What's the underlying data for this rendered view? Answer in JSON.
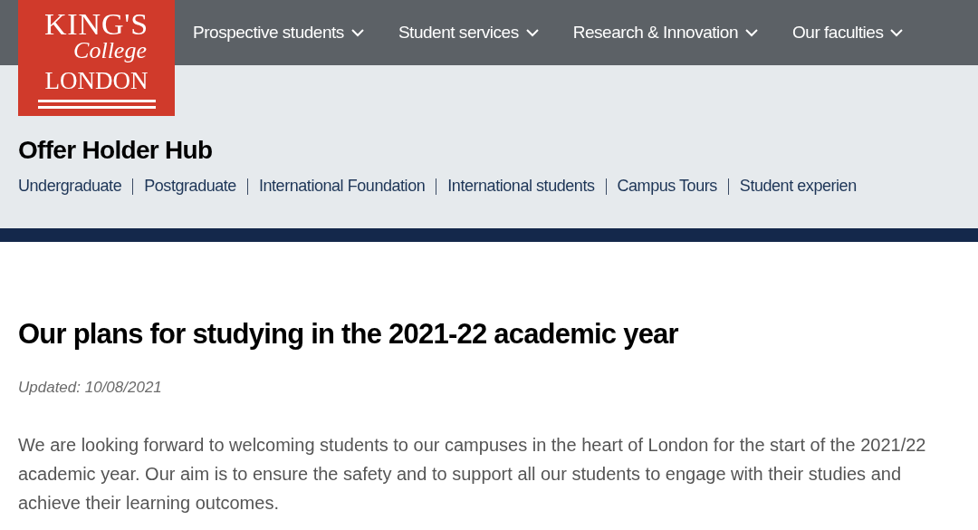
{
  "logo": {
    "line_1": "KING'S",
    "line_2": "College",
    "line_3": "LONDON"
  },
  "main_nav": [
    {
      "label": "Prospective students"
    },
    {
      "label": "Student services"
    },
    {
      "label": "Research & Innovation"
    },
    {
      "label": "Our faculties"
    }
  ],
  "section_title": "Offer Holder Hub",
  "sub_nav": [
    "Undergraduate",
    "Postgraduate",
    "International Foundation",
    "International students",
    "Campus Tours",
    "Student experien"
  ],
  "article": {
    "heading": "Our plans for studying in the 2021-22 academic year",
    "updated": "Updated: 10/08/2021",
    "body": "We are looking forward to welcoming students to our campuses in the heart of London for the start of the 2021/22 academic year. Our aim is to ensure the safety and to support all our students to engage with their studies and achieve their learning outcomes."
  }
}
